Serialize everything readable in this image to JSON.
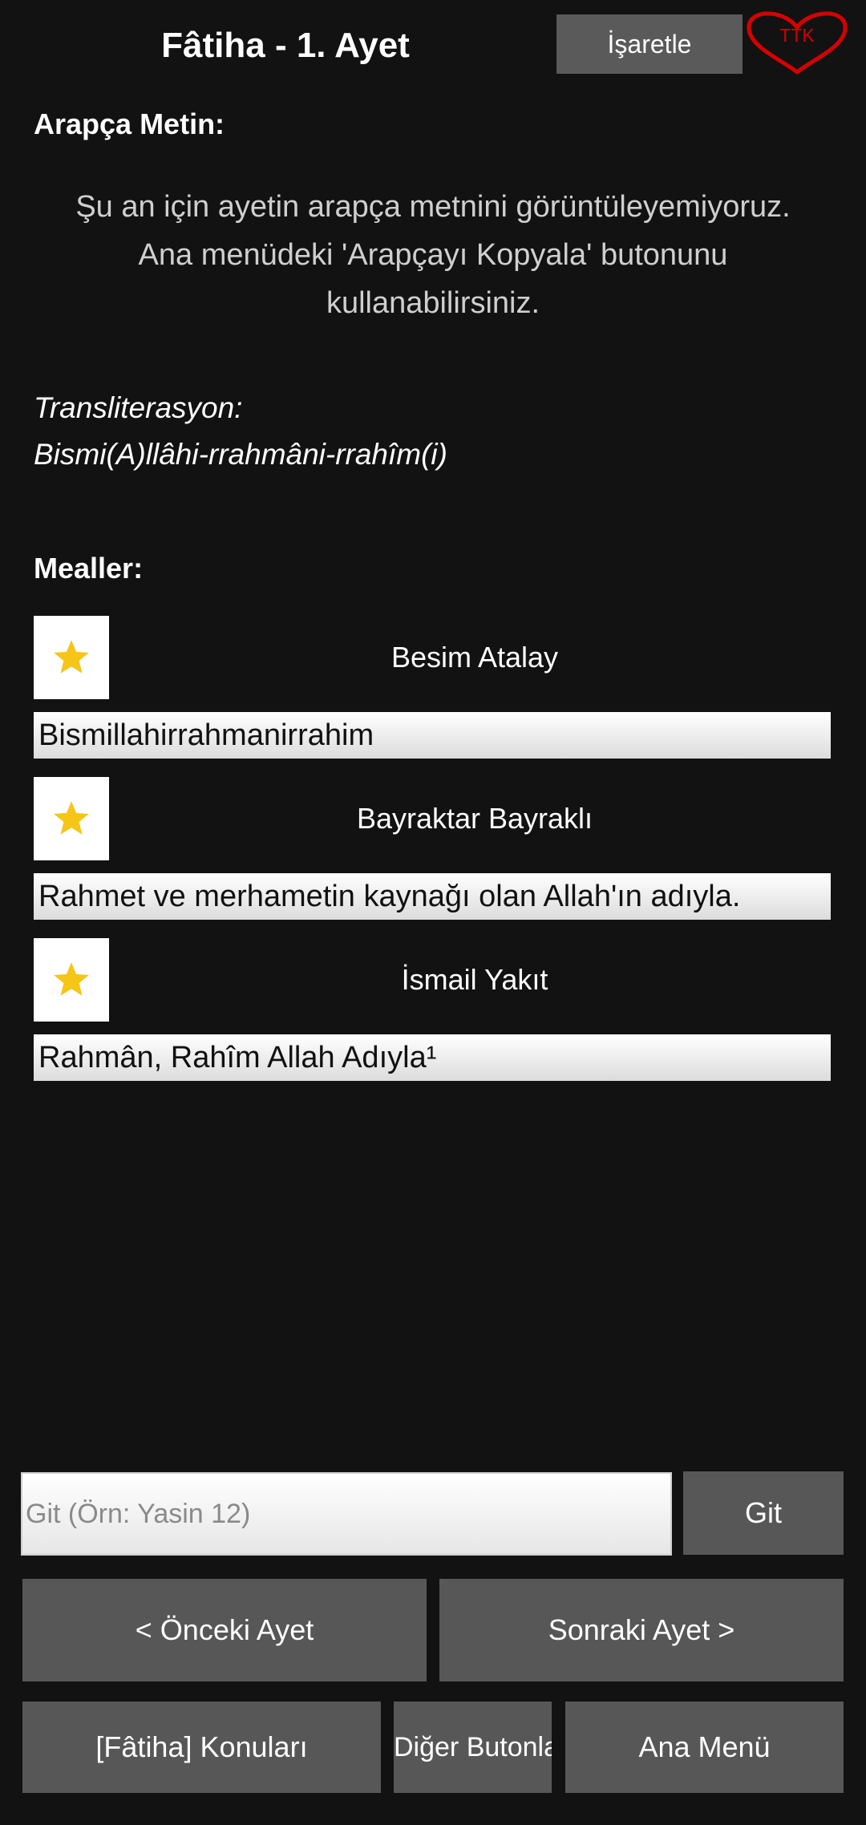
{
  "header": {
    "title": "Fâtiha - 1. Ayet",
    "mark_label": "İşaretle",
    "logo_text": "TTK"
  },
  "arabic": {
    "label": "Arapça Metin:",
    "message_lines": [
      "Şu an için ayetin arapça metnini görüntüleyemiyoruz.",
      "Ana menüdeki 'Arapçayı Kopyala' butonunu",
      "kullanabilirsiniz."
    ]
  },
  "transliteration": {
    "label": "Transliterasyon:",
    "text": "Bismi(A)llâhi-rrahmâni-rrahîm(i)"
  },
  "mealler": {
    "label": "Mealler:",
    "items": [
      {
        "translator": "Besim Atalay",
        "text": "Bismillahirrahmanirrahim"
      },
      {
        "translator": "Bayraktar Bayraklı",
        "text": "Rahmet ve merhametin kaynağı olan Allah'ın adıyla."
      },
      {
        "translator": "İsmail Yakıt",
        "text": "Rahmân, Rahîm Allah Adıyla¹"
      }
    ]
  },
  "goto": {
    "placeholder": "Git (Örn: Yasin 12)",
    "value": "",
    "button_label": "Git"
  },
  "nav": {
    "prev_label": "< Önceki Ayet",
    "next_label": "Sonraki Ayet >",
    "topics_label": "[Fâtiha] Konuları",
    "other_label": "Diğer Butonlar..",
    "main_menu_label": "Ana Menü"
  },
  "colors": {
    "background": "#121212",
    "button": "#575757",
    "star": "#f5c518",
    "logo": "#d60000"
  },
  "icons": {
    "favorite": "star-icon",
    "logo": "heart-logo"
  }
}
